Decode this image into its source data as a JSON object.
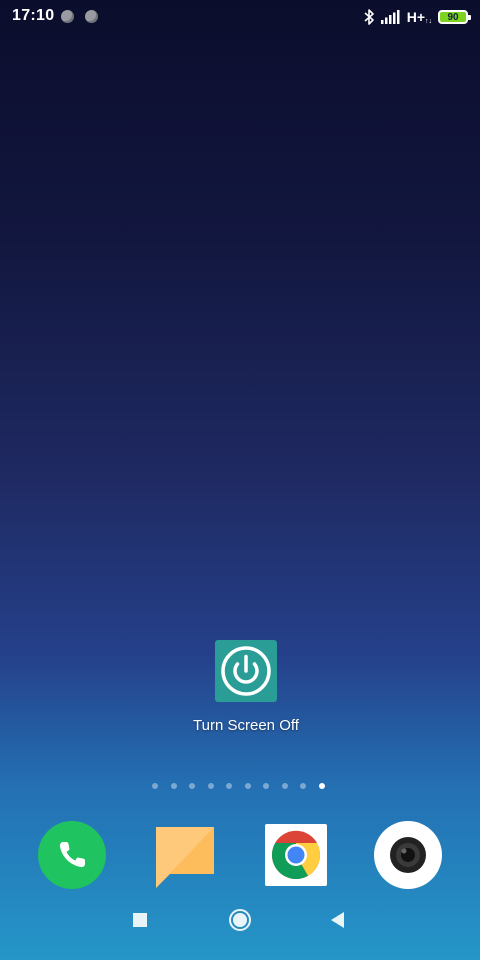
{
  "status_bar": {
    "time": "17:10",
    "network_label": "H+",
    "network_sub": "↑↓",
    "battery_level": "90",
    "battery_color": "#7ed321",
    "icons": [
      "bluetooth-icon",
      "signal-icon",
      "battery-icon"
    ]
  },
  "home": {
    "app": {
      "label": "Turn Screen Off",
      "icon": "power-icon",
      "icon_color": "#2a9d96"
    },
    "page_indicator": {
      "count": 10,
      "active_index": 9
    }
  },
  "dock": {
    "items": [
      {
        "name": "phone",
        "icon": "phone-icon",
        "color": "#1fc35f"
      },
      {
        "name": "messages",
        "icon": "message-icon",
        "color": "#fdbd5d"
      },
      {
        "name": "chrome",
        "icon": "chrome-icon",
        "color": "#ffffff"
      },
      {
        "name": "camera",
        "icon": "camera-icon",
        "color": "#ffffff"
      }
    ]
  },
  "nav_bar": {
    "buttons": [
      "recents-button",
      "home-button",
      "back-button"
    ]
  },
  "colors": {
    "wallpaper_top": "#0b0d2c",
    "wallpaper_bottom": "#2596c8"
  }
}
